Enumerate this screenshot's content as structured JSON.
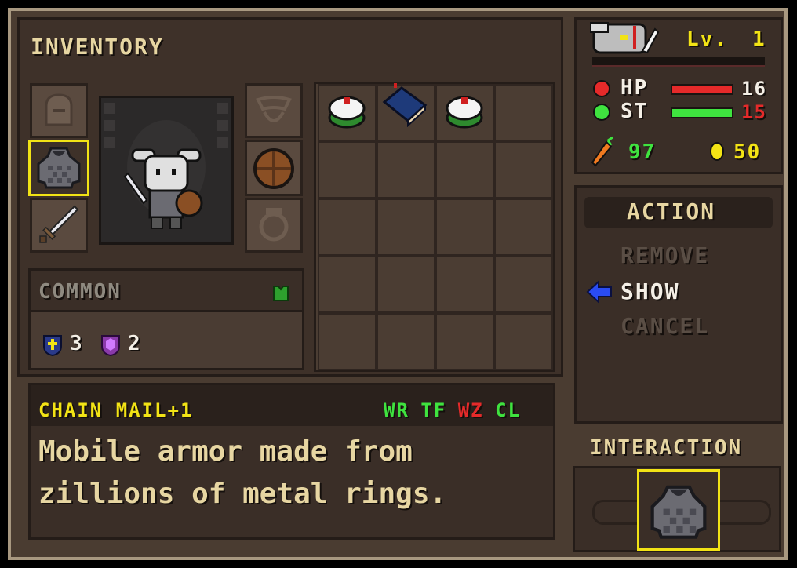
{
  "inventory": {
    "title": "INVENTORY"
  },
  "item_info": {
    "rarity": "COMMON",
    "stats": [
      {
        "icon": "cross-shield",
        "value": "3"
      },
      {
        "icon": "purple-gem-shield",
        "value": "2"
      }
    ]
  },
  "description": {
    "name": "CHAIN MAIL+1",
    "tags": [
      {
        "label": "WR",
        "color": "#3fe33f"
      },
      {
        "label": "TF",
        "color": "#3fe33f"
      },
      {
        "label": "WZ",
        "color": "#e52a2a"
      },
      {
        "label": "CL",
        "color": "#3fe33f"
      }
    ],
    "text_line1": "Mobile armor made from",
    "text_line2": "zillions of metal rings."
  },
  "status": {
    "level_label": "Lv.",
    "level": "1",
    "hp_label": "HP",
    "hp_value": "16",
    "st_label": "ST",
    "st_value": "15",
    "food": "97",
    "gold": "50"
  },
  "action": {
    "title": "ACTION",
    "items": [
      {
        "label": "REMOVE",
        "enabled": false
      },
      {
        "label": "SHOW",
        "enabled": true,
        "selected": true
      },
      {
        "label": "CANCEL",
        "enabled": false
      }
    ]
  },
  "interaction": {
    "title": "INTERACTION"
  },
  "colors": {
    "frame": "#a89880",
    "panel": "#3a2e27",
    "highlight": "#f2e315",
    "hp_bar": "#e52a2a",
    "st_bar": "#3fe33f"
  }
}
